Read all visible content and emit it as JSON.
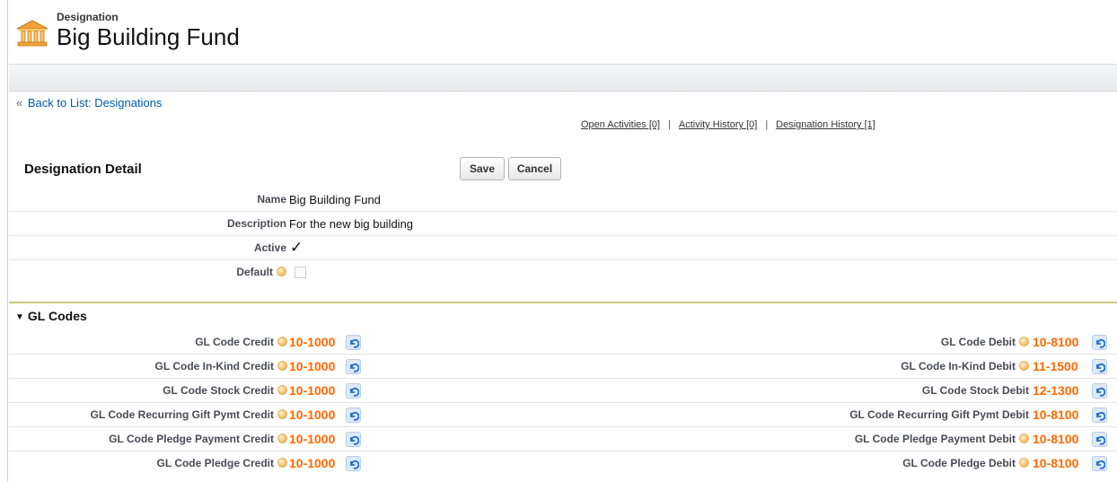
{
  "header": {
    "object_type": "Designation",
    "record_name": "Big Building Fund",
    "logo_icon": "bank-building-icon"
  },
  "nav": {
    "back_link": "Back to List: Designations",
    "related_links": [
      "Open Activities [0]",
      "Activity History [0]",
      "Designation History [1]"
    ]
  },
  "detail": {
    "section_title": "Designation Detail",
    "save_label": "Save",
    "cancel_label": "Cancel",
    "fields": [
      {
        "label": "Name",
        "value": "Big Building Fund"
      },
      {
        "label": "Description",
        "value": "For the new big building"
      },
      {
        "label": "Active",
        "checked": true
      },
      {
        "label": "Default",
        "checked": false
      }
    ]
  },
  "gl_codes": {
    "section_title": "GL Codes",
    "accent_color": "#ff6a00",
    "left": [
      {
        "label": "GL Code Credit",
        "value": "10-1000",
        "help": true
      },
      {
        "label": "GL Code In-Kind Credit",
        "value": "10-1000",
        "help": true
      },
      {
        "label": "GL Code Stock Credit",
        "value": "10-1000",
        "help": true
      },
      {
        "label": "GL Code Recurring Gift Pymt Credit",
        "value": "10-1000",
        "help": true
      },
      {
        "label": "GL Code Pledge Payment Credit",
        "value": "10-1000",
        "help": true
      },
      {
        "label": "GL Code Pledge Credit",
        "value": "10-1000",
        "help": true
      }
    ],
    "right": [
      {
        "label": "GL Code Debit",
        "value": "10-8100",
        "help": true
      },
      {
        "label": "GL Code In-Kind Debit",
        "value": "11-1500",
        "help": true
      },
      {
        "label": "GL Code Stock Debit",
        "value": "12-1300",
        "help": false
      },
      {
        "label": "GL Code Recurring Gift Pymt Debit",
        "value": "10-8100",
        "help": false
      },
      {
        "label": "GL Code Pledge Payment Debit",
        "value": "10-8100",
        "help": true
      },
      {
        "label": "GL Code Pledge Debit",
        "value": "10-8100",
        "help": true
      }
    ]
  }
}
